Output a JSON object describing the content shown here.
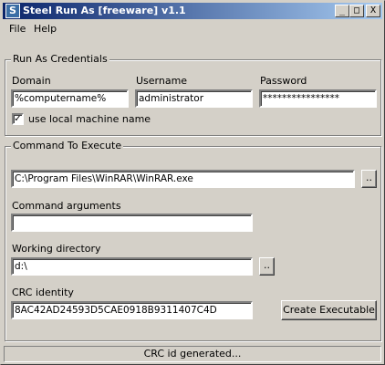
{
  "window": {
    "title": "Steel Run As [freeware] v1.1",
    "minimize_label": "_",
    "maximize_label": "□",
    "close_label": "X"
  },
  "menu": {
    "file": "File",
    "help": "Help"
  },
  "credentials": {
    "group_title": "Run As Credentials",
    "domain_label": "Domain",
    "domain_value": "%computername%",
    "username_label": "Username",
    "username_value": "administrator",
    "password_label": "Password",
    "password_value": "****************",
    "use_local_label": "use local machine name",
    "use_local_checked": "✓"
  },
  "command": {
    "group_title": "Command To Execute",
    "path_value": "C:\\Program Files\\WinRAR\\WinRAR.exe",
    "browse_label": "..",
    "args_label": "Command arguments",
    "args_value": "",
    "workdir_label": "Working directory",
    "workdir_value": "d:\\",
    "workdir_browse_label": "..",
    "crc_label": "CRC identity",
    "crc_value": "8AC42AD24593D5CAE0918B9311407C4D",
    "create_button": "Create Executable"
  },
  "status": {
    "text": "CRC id generated..."
  }
}
